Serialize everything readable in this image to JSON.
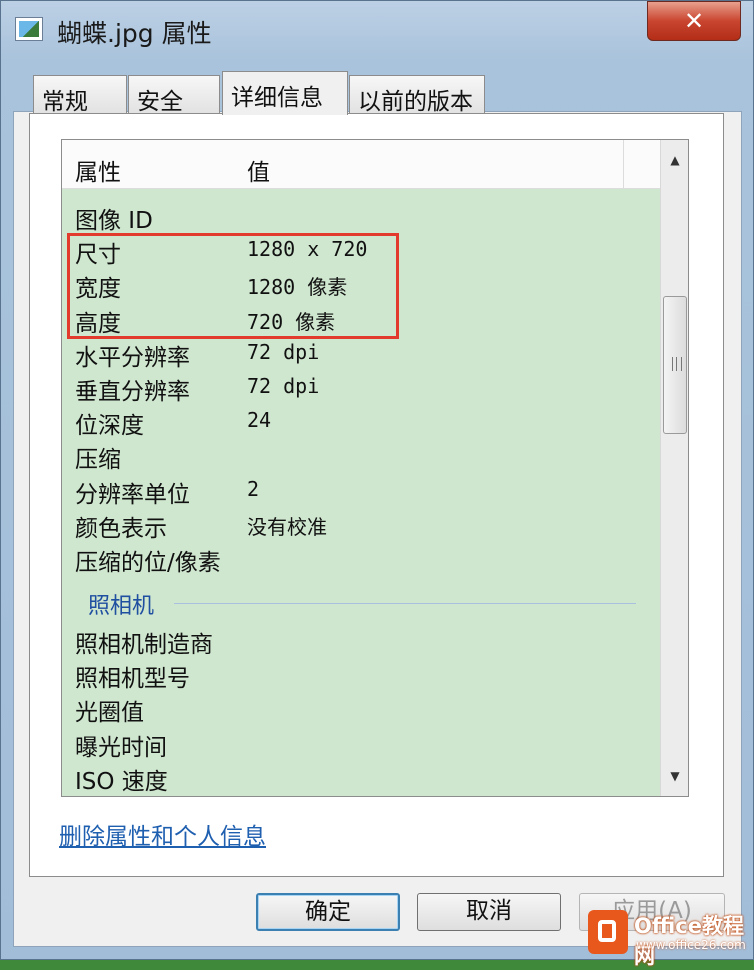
{
  "window": {
    "title": "蝴蝶.jpg 属性",
    "close_label": "✕"
  },
  "tabs": [
    {
      "label": "常规",
      "active": false
    },
    {
      "label": "安全",
      "active": false
    },
    {
      "label": "详细信息",
      "active": true
    },
    {
      "label": "以前的版本",
      "active": false
    }
  ],
  "details": {
    "columns": {
      "property": "属性",
      "value": "值"
    },
    "rows": [
      {
        "property": "图像 ID",
        "value": ""
      },
      {
        "property": "尺寸",
        "value": "1280 x 720"
      },
      {
        "property": "宽度",
        "value": "1280 像素"
      },
      {
        "property": "高度",
        "value": "720 像素"
      },
      {
        "property": "水平分辨率",
        "value": "72 dpi"
      },
      {
        "property": "垂直分辨率",
        "value": "72 dpi"
      },
      {
        "property": "位深度",
        "value": "24"
      },
      {
        "property": "压缩",
        "value": ""
      },
      {
        "property": "分辨率单位",
        "value": "2"
      },
      {
        "property": "颜色表示",
        "value": "没有校准"
      },
      {
        "property": "压缩的位/像素",
        "value": ""
      }
    ],
    "group": "照相机",
    "group_rows": [
      {
        "property": "照相机制造商",
        "value": ""
      },
      {
        "property": "照相机型号",
        "value": ""
      },
      {
        "property": "光圈值",
        "value": ""
      },
      {
        "property": "曝光时间",
        "value": ""
      },
      {
        "property": "ISO 速度",
        "value": ""
      }
    ]
  },
  "remove_link": "删除属性和个人信息",
  "buttons": {
    "ok": "确定",
    "cancel": "取消",
    "apply": "应用(A)"
  },
  "watermark": {
    "name": "Office教程网",
    "url": "www.office26.com"
  },
  "colors": {
    "list_bg": "#cfe6cf",
    "highlight": "#e23b2e",
    "link": "#1f5fb0"
  }
}
